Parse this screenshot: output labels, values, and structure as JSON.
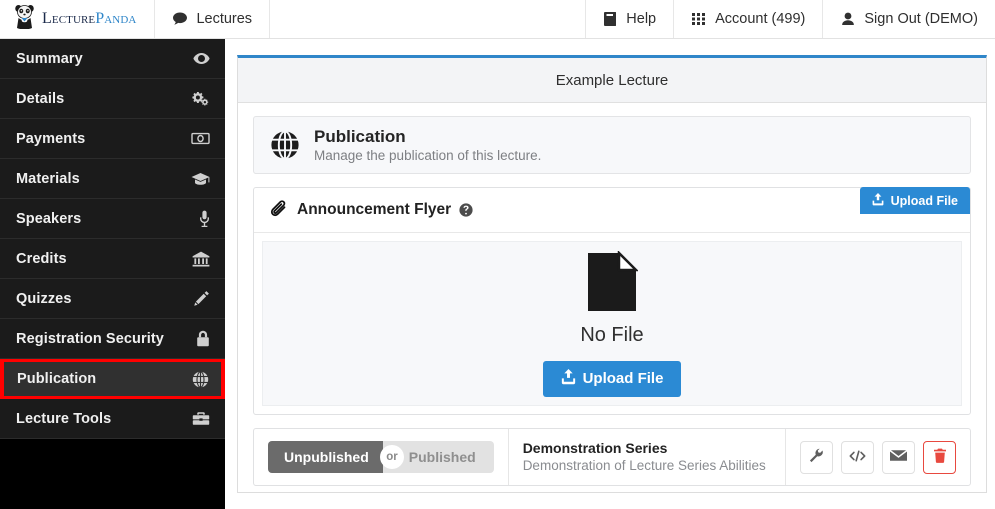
{
  "brand": {
    "word1": "Lecture",
    "word2": "Panda",
    "icon": "panda-logo-icon"
  },
  "topnav": {
    "left": [
      {
        "label": "Lectures",
        "icon": "comment-icon",
        "active": true
      }
    ],
    "right": [
      {
        "label": "Help",
        "icon": "book-icon"
      },
      {
        "label": "Account (499)",
        "icon": "grid-icon"
      },
      {
        "label": "Sign Out (DEMO)",
        "icon": "user-icon"
      }
    ]
  },
  "sidebar": {
    "items": [
      {
        "label": "Summary",
        "icon": "eye-icon",
        "selected": false
      },
      {
        "label": "Details",
        "icon": "gears-icon",
        "selected": false
      },
      {
        "label": "Payments",
        "icon": "money-icon",
        "selected": false
      },
      {
        "label": "Materials",
        "icon": "graduation-cap-icon",
        "selected": false
      },
      {
        "label": "Speakers",
        "icon": "microphone-icon",
        "selected": false
      },
      {
        "label": "Credits",
        "icon": "bank-icon",
        "selected": false
      },
      {
        "label": "Quizzes",
        "icon": "pencil-icon",
        "selected": false
      },
      {
        "label": "Registration Security",
        "icon": "lock-icon",
        "selected": false
      },
      {
        "label": "Publication",
        "icon": "globe-icon",
        "selected": true
      },
      {
        "label": "Lecture Tools",
        "icon": "briefcase-icon",
        "selected": false
      }
    ],
    "highlight_color": "#ff0000"
  },
  "panel": {
    "title": "Example Lecture",
    "accent_color": "#2f86c9",
    "banner": {
      "icon": "globe-icon",
      "heading": "Publication",
      "subheading": "Manage the publication of this lecture."
    },
    "flyer_card": {
      "title": "Announcement Flyer",
      "title_icon": "paperclip-icon",
      "help_icon": "question-circle-icon",
      "upload_top_label": "Upload File",
      "upload_top_icon": "upload-icon",
      "empty_state_icon": "file-icon",
      "empty_state_text": "No File",
      "upload_big_label": "Upload File",
      "upload_big_icon": "upload-icon",
      "button_color": "#2b8ad4"
    },
    "series_row": {
      "toggle": {
        "active_label": "Unpublished",
        "separator_label": "or",
        "inactive_label": "Published",
        "active_state": "Unpublished"
      },
      "name": "Demonstration Series",
      "description": "Demonstration of Lecture Series Abilities",
      "actions": [
        {
          "name": "settings",
          "icon": "wrench-icon",
          "danger": false
        },
        {
          "name": "embed-code",
          "icon": "code-icon",
          "danger": false
        },
        {
          "name": "email",
          "icon": "envelope-icon",
          "danger": false
        },
        {
          "name": "delete",
          "icon": "trash-icon",
          "danger": true
        }
      ],
      "danger_color": "#e8493f"
    }
  }
}
